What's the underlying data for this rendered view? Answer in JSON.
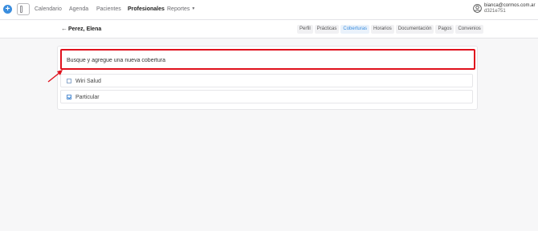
{
  "topnav": {
    "items": [
      {
        "label": "Calendario",
        "active": false
      },
      {
        "label": "Agenda",
        "active": false
      },
      {
        "label": "Pacientes",
        "active": false
      },
      {
        "label": "Profesionales",
        "active": true
      },
      {
        "label": "Reportes",
        "active": false,
        "dropdown": true
      }
    ],
    "add_icon": "plus-icon",
    "toggle_icon": "sidebar-toggle-icon",
    "user": {
      "email": "bianca@cormos.com.ar",
      "id": "d321e751",
      "icon": "user-circle-icon"
    }
  },
  "subheader": {
    "back_icon": "arrow-left-icon",
    "title": "Perez, Elena",
    "tabs": [
      {
        "label": "Perfil",
        "active": false
      },
      {
        "label": "Prácticas",
        "active": false
      },
      {
        "label": "Coberturas",
        "active": true
      },
      {
        "label": "Horarios",
        "active": false
      },
      {
        "label": "Documentación",
        "active": false
      },
      {
        "label": "Pagos",
        "active": false
      },
      {
        "label": "Convenios",
        "active": false
      }
    ]
  },
  "coverage": {
    "search_placeholder": "Busque y agregue una nueva cobertura",
    "items": [
      {
        "label": "Wiri Salud",
        "checked": false
      },
      {
        "label": "Particular",
        "checked": true
      }
    ]
  },
  "colors": {
    "accent": "#3a8dde",
    "highlight": "#e0111d"
  }
}
